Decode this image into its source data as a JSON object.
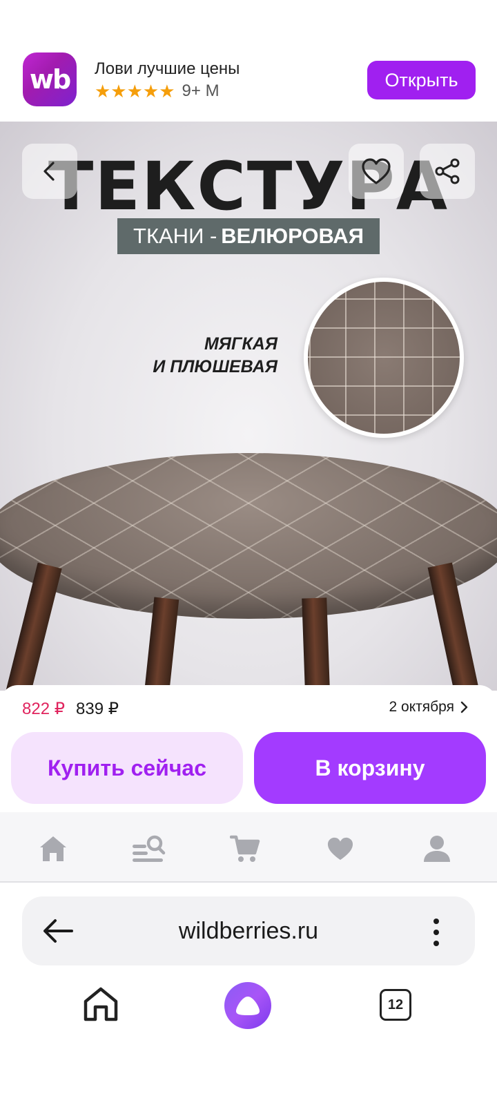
{
  "app_banner": {
    "logo_text": "wb",
    "title": "Лови лучшие цены",
    "stars": "★★★★★",
    "downloads": "9+ M",
    "open_label": "Открыть"
  },
  "product_image": {
    "headline": "ТЕКСТУРА",
    "subhead_light": "ТКАНИ -",
    "subhead_bold": "ВЕЛЮРОВАЯ",
    "feature_line1": "МЯГКАЯ",
    "feature_line2": "И ПЛЮШЕВАЯ"
  },
  "icons": {
    "back": "chevron-left-icon",
    "favorite": "heart-icon",
    "share": "share-icon",
    "nav": [
      "home-icon",
      "search-catalog-icon",
      "cart-icon",
      "heart-icon",
      "profile-icon"
    ],
    "browser": [
      "arrow-left-icon",
      "more-vertical-icon",
      "home-icon",
      "alice-icon",
      "tabs-icon"
    ]
  },
  "price": {
    "current": "822 ₽",
    "old": "839 ₽",
    "delivery": "2 октября"
  },
  "actions": {
    "buy_now": "Купить сейчас",
    "add_to_cart": "В корзину"
  },
  "browser": {
    "url": "wildberries.ru",
    "tabs_count": "12"
  },
  "colors": {
    "brand": "#a020f0",
    "price_accent": "#e0245e",
    "stars": "#f59e0b"
  }
}
